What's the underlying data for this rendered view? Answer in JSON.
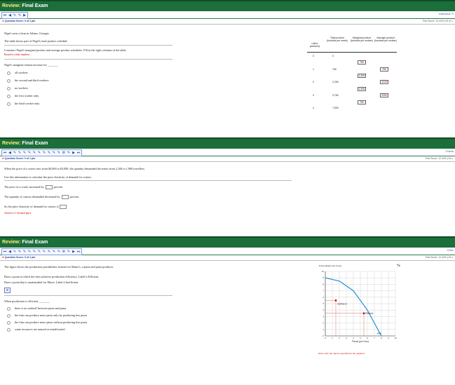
{
  "colors": {
    "header_bg": "#1c6e3a",
    "header_accent": "#ffef7a",
    "error_red": "#cc0000",
    "link_blue": "#3355aa"
  },
  "panel1": {
    "header": {
      "prefix": "Review:",
      "title": "Final Exam"
    },
    "toolbar_link": "Instructor Ti",
    "info_left": "Question Score: 0 of 1 pts",
    "info_right": "Test Score: 12.44% (19 of 1",
    "q1": "Nigel owns a farm in Athens, Georgia",
    "q2": "The table shows part of Nigel's total product schedule",
    "q3": "Construct Nigel's marginal product and average product schedules. Fill in the right columns of the table.",
    "q3_note": "Round to whole numbers",
    "q4": "Nigel's marginal returns increase for _______",
    "options": [
      "all workers",
      "the second and third workers",
      "no workers",
      "the first worker only",
      "the third worker only"
    ],
    "table": {
      "headers": [
        "Labor (workers)",
        "Total product (bushels per week)",
        "Marginal product (bushels per worker)",
        "Average product (bushels per worker)"
      ],
      "labor": [
        "0",
        "1",
        "2",
        "3",
        "4"
      ],
      "total": [
        "0",
        "750",
        "2,250",
        "3,750",
        "7,500"
      ],
      "marginal": [
        "750",
        "1,500",
        "1,500",
        "750"
      ],
      "average": [
        "750",
        "1125",
        "2250"
      ]
    }
  },
  "panel2": {
    "header": {
      "prefix": "Review:",
      "title": "Final Exam"
    },
    "toolbar_link": "Check",
    "info_left": "Question Score: 0 of 1 pts",
    "info_right": "Test Score: 12.44% (19 o",
    "q1": "When the price of a cruise rises from $4,000 to $3,000, the quantity demanded decreases from 2,100 to 1,900 travellers.",
    "q2": "Use this information to calculate the price elasticity of demand for cruises.",
    "q3_a": "The price of a cruise increased by",
    "q3_b": "percent.",
    "q4_a": "The quantity of cruises demanded decreased by",
    "q4_b": "percent.",
    "q5": "So the price elasticity of demand for cruises is",
    "q5_note": "Answer to 1 decimal place"
  },
  "panel3": {
    "header": {
      "prefix": "Review:",
      "title": "Final Exam"
    },
    "toolbar_link": "Chec",
    "info_left": "Question Score: 0 of 1 pts",
    "info_right": "Test Score: 12.44% (19 o",
    "q1": "The figure shows the production possibilities frontier for Mario's, a pizza and pasta producer.",
    "q2": "Draw a point at which the firm achieves production efficiency. Label it Efficient.",
    "q3": "Draw a point that is unattainable for Mario. Label it Inefficient.",
    "q4": "When production is efficient, _______",
    "options": [
      "there is no tradeoff between pizza and pasta",
      "the firm can produce more pasta only by producing less pizza",
      "the firm can produce more pasta without producing less pizza",
      "some resources are unused or misallocated"
    ],
    "chart_caption": "Pasta (dishes per hour)",
    "percent_sign": "%",
    "x_axis_label": "Pizzas (per hour)",
    "label_inefficient": "Inefficient",
    "label_efficient": "Efficient",
    "label_ppf": "PPF",
    "chart_note": "Draw only the objects specified in the question.",
    "chart_data": {
      "type": "line",
      "xlabel": "Pizzas (per hour)",
      "ylabel": "Pasta (dishes per hour)",
      "xlim": [
        0,
        10
      ],
      "ylim": [
        0,
        10
      ],
      "series": [
        {
          "name": "PPF",
          "x": [
            0,
            2,
            4,
            6,
            7,
            8
          ],
          "y": [
            9,
            8.5,
            7,
            4,
            2,
            0
          ]
        }
      ],
      "x_ticks": [
        "0",
        "1",
        "2",
        "3",
        "4",
        "5",
        "6",
        "7",
        "8",
        "9",
        "10"
      ],
      "y_ticks": [
        "0",
        "1",
        "2",
        "3",
        "4",
        "5",
        "6",
        "7",
        "8",
        "9",
        "10"
      ],
      "points": [
        {
          "label": "Inefficient",
          "x": 1.5,
          "y": 5.5
        },
        {
          "label": "Efficient",
          "x": 5.5,
          "y": 3.5
        }
      ]
    }
  }
}
